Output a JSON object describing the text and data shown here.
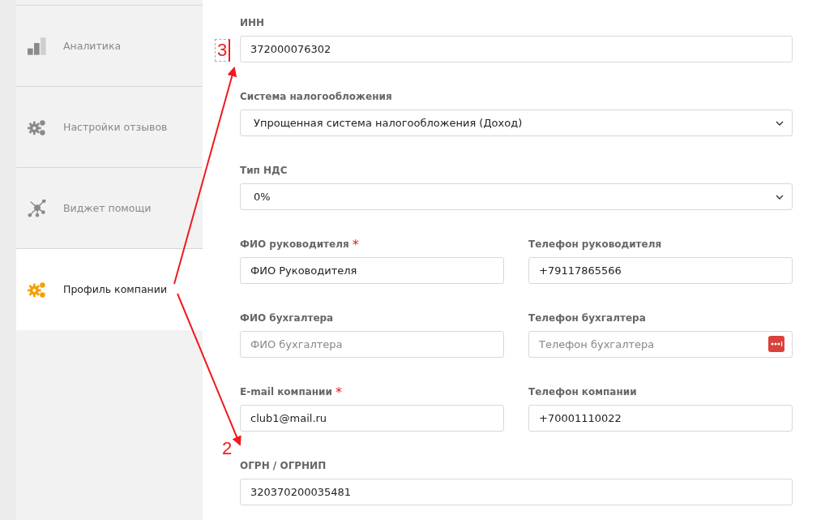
{
  "sidebar": {
    "items": [
      {
        "label": "Аналитика",
        "selected": false
      },
      {
        "label": "Настройки отзывов",
        "selected": false
      },
      {
        "label": "Виджет помощи",
        "selected": false
      },
      {
        "label": "Профиль компании",
        "selected": true
      }
    ]
  },
  "form": {
    "rows": [
      {
        "fields": [
          {
            "label": "ИНН",
            "kind": "text",
            "value": "372000076302"
          }
        ]
      },
      {
        "fields": [
          {
            "label": "Система налогообложения",
            "kind": "select",
            "value": "Упрощенная система налогообложения (Доход)"
          }
        ]
      },
      {
        "fields": [
          {
            "label": "Тип НДС",
            "kind": "select",
            "value": "0%"
          }
        ]
      },
      {
        "fields": [
          {
            "label": "ФИО руководителя",
            "required_mark": "*",
            "kind": "text",
            "value": "ФИО Руководителя"
          },
          {
            "label": "Телефон руководителя",
            "kind": "text",
            "value": "+79117865566"
          }
        ]
      },
      {
        "fields": [
          {
            "label": "ФИО бухгалтера",
            "kind": "text",
            "placeholder": "ФИО бухгалтера"
          },
          {
            "label": "Телефон бухгалтера",
            "kind": "text_action",
            "placeholder": "Телефон бухгалтера"
          }
        ]
      },
      {
        "fields": [
          {
            "label": "E-mail компании",
            "required_mark": "*",
            "kind": "text",
            "value": "club1@mail.ru"
          },
          {
            "label": "Телефон компании",
            "kind": "text",
            "value": "+70001110022"
          }
        ]
      },
      {
        "fields": [
          {
            "label": "ОГРН / ОГРНИП",
            "kind": "text",
            "value": "320370200035481"
          }
        ]
      }
    ]
  },
  "annotations": [
    {
      "text": "3",
      "kind": "boxed"
    },
    {
      "text": "2",
      "kind": "plain"
    }
  ]
}
